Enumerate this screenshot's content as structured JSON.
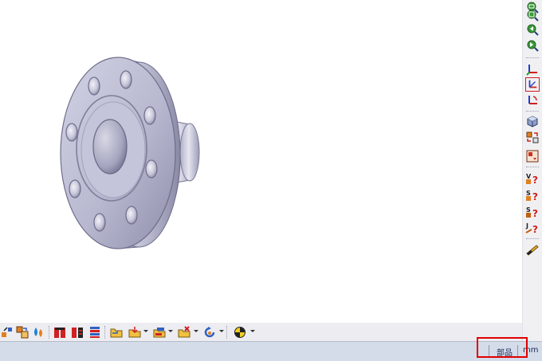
{
  "status_bar": {
    "mode_label": "部品",
    "unit_label": "mm"
  },
  "right_toolbar": {
    "icons": [
      "zoom-fit-icon",
      "zoom-window-icon",
      "view-previous-icon",
      "view-next-icon",
      "coordinate-axes-icon",
      "axis-select-icon",
      "axis-rotate-icon",
      "cube-view-icon",
      "part-swap-icon",
      "box-exchange-icon",
      "volume-query-icon",
      "surface-area-query-icon",
      "section-query-icon",
      "joint-query-icon",
      "measure-ruler-icon"
    ]
  },
  "bottom_toolbar": {
    "icons": [
      "move-parts-icon",
      "replace-part-icon",
      "color-drop-icon",
      "split-red-icon",
      "split-red-black-icon",
      "stack-icon",
      "open-folder-icon",
      "folder-arrow-icon",
      "layer-folder-icon",
      "delete-folder-icon",
      "refresh-icon",
      "center-of-gravity-icon"
    ]
  },
  "colors": {
    "status_bar_bg": "#d4dbe9",
    "highlight": "#e00000",
    "model_face": "#b9b9d1"
  }
}
